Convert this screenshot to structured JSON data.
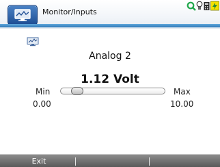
{
  "window": {
    "title": "Monitor/Inputs",
    "app_icon": "monitor-graph-icon"
  },
  "status_bar": {
    "icons": [
      "search-icon",
      "lightbulb-icon",
      "calculator-icon",
      "battery-icon"
    ],
    "accent_colors": {
      "search": "#1fa74a",
      "battery": "#f3e100",
      "header_underline": "#3f8cc9"
    }
  },
  "monitor": {
    "small_icon": "monitor-icon",
    "channel": "Analog 2",
    "reading": "1.12 Volt",
    "min_label": "Min",
    "max_label": "Max",
    "min_value": "0.00",
    "max_value": "10.00",
    "level_fraction": 0.112
  },
  "softkeys": {
    "items": [
      {
        "label": "Exit"
      },
      {
        "label": ""
      },
      {
        "label": ""
      }
    ]
  }
}
